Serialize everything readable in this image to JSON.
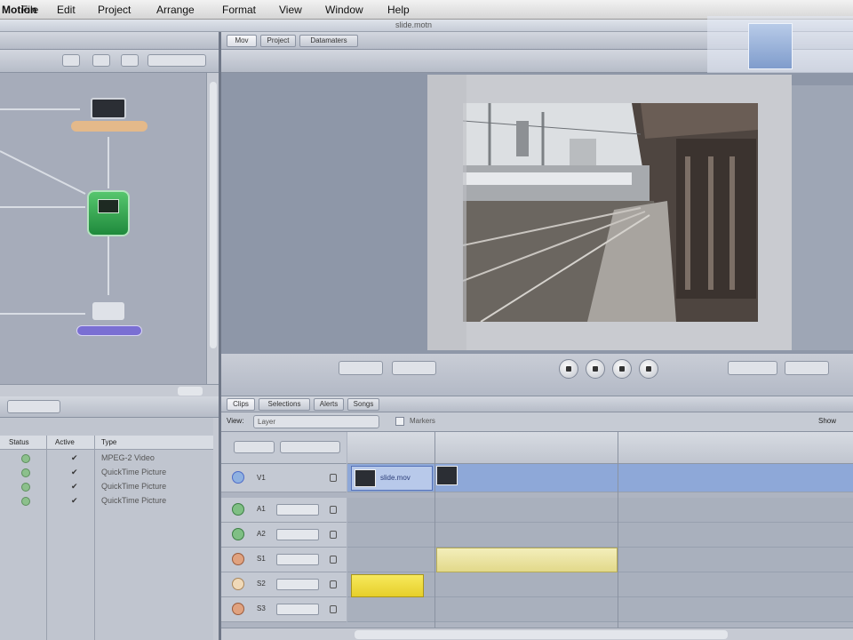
{
  "menubar": {
    "items": [
      "Motion",
      "File",
      "Edit",
      "Project",
      "Arrange",
      "Format",
      "View",
      "Window",
      "Help"
    ]
  },
  "window": {
    "title": "slide.motn"
  },
  "viewer": {
    "tabs": [
      "Mov",
      "Project",
      "Datamaters"
    ]
  },
  "timeline": {
    "tabs": [
      "Clips",
      "Selections",
      "Alerts",
      "Songs"
    ],
    "view_label": "View:",
    "view_value": "Layer",
    "marker_label": "Markers",
    "show_label": "Show"
  },
  "tracks": [
    {
      "label": "V1"
    },
    {
      "label": "A1"
    },
    {
      "label": "A2"
    },
    {
      "label": "S1"
    },
    {
      "label": "S2"
    },
    {
      "label": "S3"
    }
  ],
  "clip_label": "slide.mov",
  "media_list": {
    "headers": [
      "Status",
      "Active",
      "Type"
    ],
    "rows": [
      {
        "active": "✔",
        "type": "MPEG-2 Video"
      },
      {
        "active": "✔",
        "type": "QuickTime Picture"
      },
      {
        "active": "✔",
        "type": "QuickTime Picture"
      },
      {
        "active": "✔",
        "type": "QuickTime Picture"
      }
    ]
  },
  "colors": {
    "accent": "#4d6bc8",
    "clip_blue": "#8ea8d8",
    "clip_yellow": "#e9e29c",
    "highlight_yellow": "#f0e04a",
    "node_green": "#2fa24e",
    "node_purple": "#7a6fd3",
    "node_orange": "#e4b98a"
  },
  "icons": [
    "apple-icon",
    "film-icon",
    "filter-icon",
    "camera-icon",
    "eye-icon",
    "lock-icon",
    "play-icon",
    "stop-icon",
    "rewind-icon",
    "forward-icon"
  ]
}
